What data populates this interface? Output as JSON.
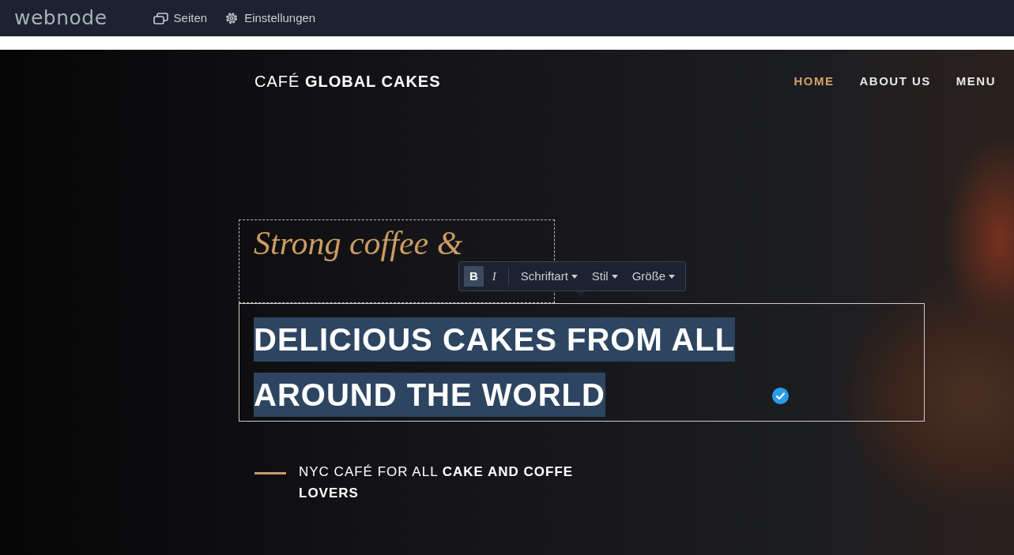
{
  "editor_bar": {
    "logo": "webnode",
    "items": [
      {
        "label": "Seiten"
      },
      {
        "label": "Einstellungen"
      }
    ]
  },
  "site": {
    "brand": {
      "light": "CAFÉ",
      "bold": "GLOBAL CAKES"
    },
    "nav": [
      {
        "label": "HOME",
        "selected": true
      },
      {
        "label": "ABOUT US",
        "selected": false
      },
      {
        "label": "MENU",
        "selected": false
      }
    ],
    "tagline": "Strong coffee &",
    "headline": "DELICIOUS CAKES FROM ALL AROUND THE WORLD",
    "subtitle": "NYC CAFÉ FOR ALL **CAKE AND COFFE LOVERS**"
  },
  "format_toolbar": {
    "buttons": [
      {
        "kind": "toggle",
        "label": "B",
        "selected": true
      },
      {
        "kind": "toggle",
        "label": "I",
        "selected": false
      },
      {
        "kind": "dropdown",
        "label": "Schriftart"
      },
      {
        "kind": "dropdown",
        "label": "Stil"
      },
      {
        "kind": "dropdown",
        "label": "Größe"
      }
    ]
  }
}
